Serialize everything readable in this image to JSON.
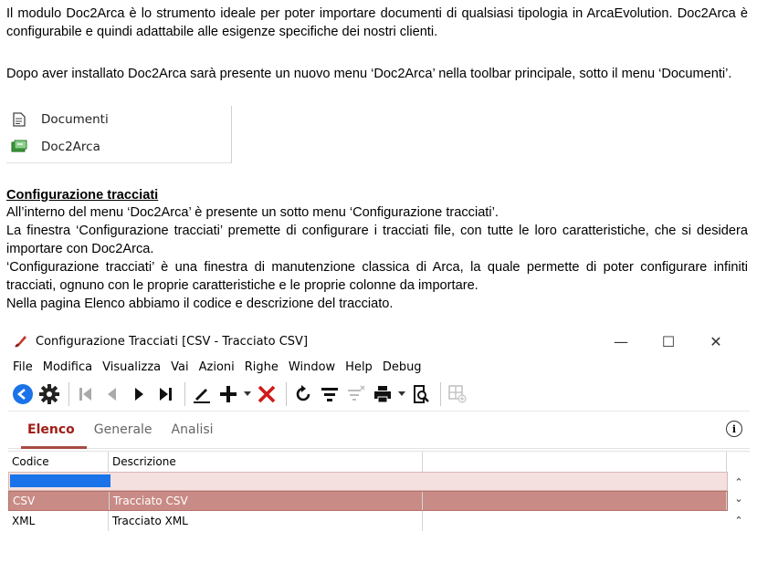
{
  "doc": {
    "para1": "Il modulo Doc2Arca è lo strumento ideale per poter importare documenti di qualsiasi tipologia in ArcaEvolution. Doc2Arca è configurabile e quindi adattabile alle esigenze specifiche dei nostri clienti.",
    "para2": "Dopo aver installato Doc2Arca sarà presente un nuovo menu ‘Doc2Arca’ nella toolbar principale, sotto il menu ‘Documenti’.",
    "menu_items": [
      "Documenti",
      "Doc2Arca"
    ],
    "section_title": "Configurazione tracciati",
    "para3a": "All’interno del menu ‘Doc2Arca’ è presente un sotto menu ‘Configurazione tracciati’.",
    "para3b": "La finestra ‘Configurazione tracciati’ premette di configurare i tracciati file, con tutte le loro caratteristiche, che si desidera importare con Doc2Arca.",
    "para3c": "‘Configurazione tracciati’ è una finestra di manutenzione classica di Arca, la quale permette di poter configurare infiniti tracciati, ognuno con le proprie caratteristiche e le proprie colonne da importare.",
    "para3d": "Nella pagina Elenco abbiamo il codice e descrizione del tracciato."
  },
  "window": {
    "title": "Configurazione Tracciati [CSV - Tracciato CSV]",
    "controls": [
      "—",
      "☐",
      "✕"
    ],
    "menu": [
      "File",
      "Modifica",
      "Visualizza",
      "Vai",
      "Azioni",
      "Righe",
      "Window",
      "Help",
      "Debug"
    ],
    "tabs": [
      "Elenco",
      "Generale",
      "Analisi"
    ],
    "info_glyph": "i",
    "columns": [
      "Codice",
      "Descrizione"
    ],
    "rows": [
      {
        "codice": "CSV",
        "descrizione": "Tracciato CSV",
        "selected": true
      },
      {
        "codice": "XML",
        "descrizione": "Tracciato XML",
        "selected": false
      }
    ],
    "colors": {
      "accent": "#a01e17",
      "selected_row": "#c98b85",
      "filter_row": "#f3e0df",
      "blue": "#1a73e8"
    }
  }
}
